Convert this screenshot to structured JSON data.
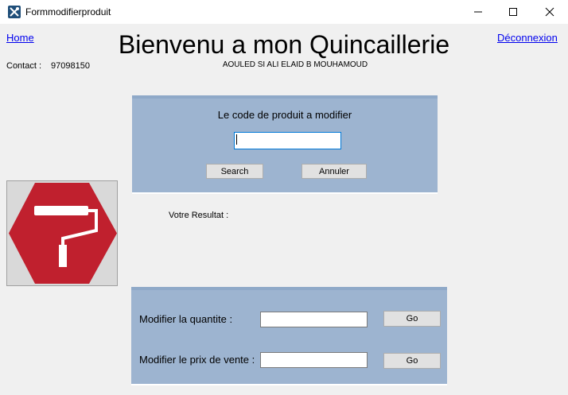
{
  "window": {
    "title": "Formmodifierproduit",
    "controls": [
      "minimize",
      "maximize",
      "close"
    ]
  },
  "header": {
    "home_link": "Home",
    "logout_link": "Déconnexion",
    "title": "Bienvenu a mon Quincaillerie",
    "subtitle": "AOULED SI ALI ELAID B MOUHAMOUD",
    "contact_label": "Contact :",
    "contact_value": "97098150"
  },
  "search_panel": {
    "prompt": "Le code de produit a modifier",
    "code_value": "",
    "search_label": "Search",
    "cancel_label": "Annuler"
  },
  "result": {
    "label": "Votre Resultat :"
  },
  "modify_panel": {
    "quantity_label": "Modifier la quantite :",
    "quantity_value": "",
    "quantity_go_label": "Go",
    "price_label": "Modifier le prix de vente :",
    "price_value": "",
    "price_go_label": "Go"
  },
  "logo": {
    "icon": "paint-roller-icon",
    "colors": {
      "hexagon": "#c0202e",
      "roller": "#ffffff",
      "background": "#d9d9d9"
    }
  },
  "colors": {
    "panel": "#9db4d0",
    "link": "#0000ee",
    "window_bg": "#f0f0f0"
  }
}
